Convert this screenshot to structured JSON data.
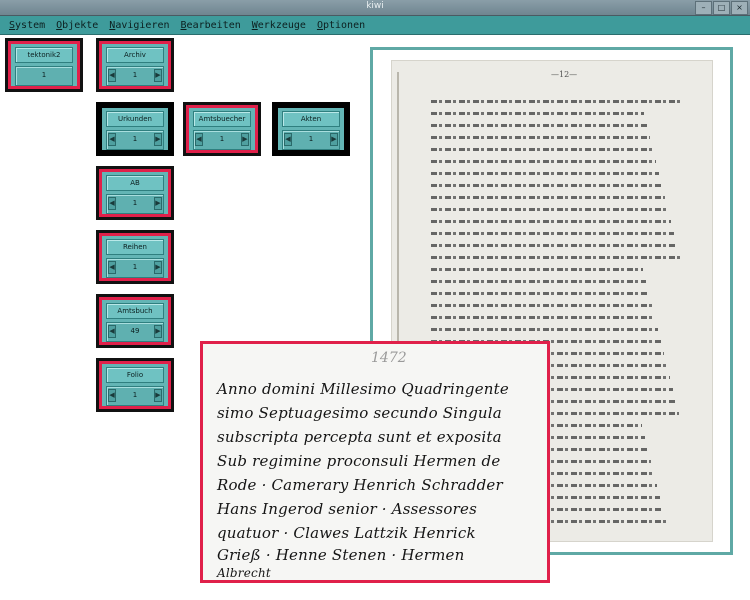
{
  "window": {
    "title": "kiwi"
  },
  "menu": [
    "System",
    "Objekte",
    "Navigieren",
    "Bearbeiten",
    "Werkzeuge",
    "Optionen"
  ],
  "widgets": [
    {
      "label": "tektonik2",
      "value": "1",
      "active": true
    },
    {
      "label": "Archiv",
      "value": "1",
      "active": true
    },
    {
      "label": "Urkunden",
      "value": "1",
      "active": false
    },
    {
      "label": "Amtsbuecher",
      "value": "1",
      "active": true
    },
    {
      "label": "Akten",
      "value": "1",
      "active": false
    },
    {
      "label": "AB",
      "value": "1",
      "active": true
    },
    {
      "label": "Reihen",
      "value": "1",
      "active": true
    },
    {
      "label": "Amtsbuch",
      "value": "49",
      "active": true
    },
    {
      "label": "Folio",
      "value": "1",
      "active": true
    }
  ],
  "document": {
    "page_number": "—12—"
  },
  "zoom": {
    "year_note": "1472",
    "lines": [
      "Anno domini Millesimo Quadringente",
      "simo Septuagesimo secundo Singula",
      "subscripta percepta sunt et exposita",
      "Sub regimine proconsuli Hermen de",
      "Rode · Camerary Henrich Schradder",
      "Hans Ingerod senior · Assessores",
      "quatuor · Clawes Lattzik Henrick",
      "Grieß · Henne Stenen · Hermen",
      "Albrecht"
    ]
  },
  "colors": {
    "accent": "#e0204a",
    "widget": "#63b5b5",
    "menubar": "#3e9b9b",
    "frame": "#5fa9a5"
  }
}
